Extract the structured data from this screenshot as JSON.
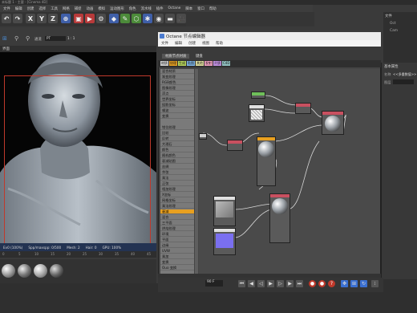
{
  "app": {
    "title": "未标题 1 - 主要 - [Cinema 4D]",
    "menu": [
      "文件",
      "编辑",
      "创建",
      "选择",
      "工具",
      "网格",
      "捕捉",
      "动画",
      "模拟",
      "运动图形",
      "角色",
      "流水线",
      "插件",
      "Octane",
      "脚本",
      "窗口",
      "帮助"
    ]
  },
  "toolbar": {
    "x_label": "X",
    "y_label": "Y",
    "z_label": "Z"
  },
  "viewport": {
    "title": "界面",
    "header_label": "界面",
    "unit_select": "PT",
    "unit_value": "1 : 1",
    "status": [
      "Ev0 (100%)",
      "Spp/maxspp: 0/500",
      "Mesh: 2",
      "Hair: 0",
      "GPU: 100%"
    ]
  },
  "ruler": {
    "ticks": [
      "0",
      "5",
      "10",
      "15",
      "20",
      "25",
      "30",
      "35",
      "40",
      "45"
    ]
  },
  "octane": {
    "title": "Octane 节点编辑器",
    "menu": [
      "文件",
      "编辑",
      "创建",
      "视图",
      "帮助"
    ],
    "tabs": [
      "材质节点材质",
      "键盘"
    ],
    "color_tags": [
      "材质",
      "纹理",
      "生成",
      "贴图",
      "其他",
      "发射",
      "介质",
      "C4D"
    ],
    "node_list": [
      "混合材质",
      "渐变纹理",
      "RGB颜色",
      "图像纹理",
      "浮点",
      "世界坐标",
      "投影坐标",
      "噪波",
      "变换",
      "钳位纹理",
      "比较",
      "反转",
      "大理石",
      "颜色",
      "随机颜色",
      "衰减贴图",
      "丝绸",
      "余弦",
      "乘法",
      "正弦",
      "相加纹理",
      "X坐标",
      "网格坐标",
      "乘法纹理",
      "混合",
      "三平面",
      "烘焙纹理",
      "环境",
      "平面",
      "边缘",
      "UVW",
      "乘加",
      "变换",
      "Ouo 变换",
      "图纸"
    ],
    "selected_item": "衰减",
    "right_panel": {
      "title": "基本属性",
      "field_name_label": "名称",
      "field_name_value": "<<多重数值>>",
      "field_layer_label": "图层"
    }
  },
  "right_panel": {
    "title": "文件",
    "items": [
      "Oct",
      "Cam"
    ]
  },
  "timeline": {
    "frame": "90 F",
    "buttons": [
      "go-start",
      "prev-key",
      "prev-frame",
      "play",
      "next-frame",
      "next-key",
      "go-end",
      "record",
      "auto-key",
      "keyframe",
      "motion"
    ]
  },
  "colors": {
    "accent_orange": "#e8a020",
    "red_frame": "#c0392b",
    "status_blue": "#233352"
  }
}
